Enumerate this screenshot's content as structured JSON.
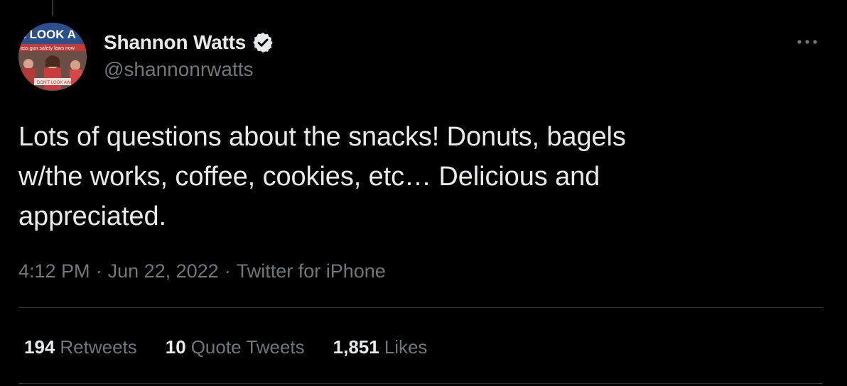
{
  "author": {
    "display_name": "Shannon Watts",
    "handle": "@shannonrwatts",
    "verified": true,
    "avatar_sign_text": "I LOOK A",
    "avatar_banner_text": "ass gun safety laws now",
    "avatar_footer_text": "DON'T LOOK AWAY"
  },
  "tweet": {
    "line1": "Lots of questions about the snacks! Donuts, bagels",
    "line2": "w/the works, coffee, cookies, etc… Delicious and",
    "line3": "appreciated."
  },
  "meta": {
    "time": "4:12 PM",
    "separator": "·",
    "date": "Jun 22, 2022",
    "source": "Twitter for iPhone"
  },
  "stats": {
    "retweets_count": "194",
    "retweets_label": "Retweets",
    "quotes_count": "10",
    "quotes_label": "Quote Tweets",
    "likes_count": "1,851",
    "likes_label": "Likes"
  },
  "colors": {
    "background": "#000000",
    "primary_text": "#e7e9ea",
    "secondary_text": "#71767b",
    "divider": "#2f3336"
  },
  "icons": {
    "verified": "verified-badge-icon",
    "more": "more-horizontal-icon"
  }
}
